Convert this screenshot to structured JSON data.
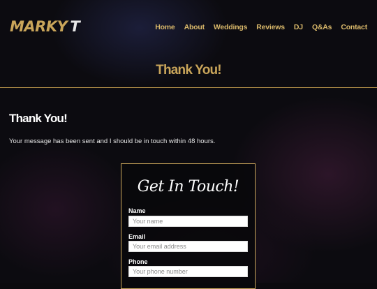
{
  "brand": {
    "logo_text": "MARKY",
    "logo_suffix": "T"
  },
  "nav": {
    "items": [
      {
        "label": "Home"
      },
      {
        "label": "About"
      },
      {
        "label": "Weddings"
      },
      {
        "label": "Reviews"
      },
      {
        "label": "DJ"
      },
      {
        "label": "Q&As"
      },
      {
        "label": "Contact"
      }
    ]
  },
  "hero": {
    "title": "Thank You!"
  },
  "content": {
    "title": "Thank You!",
    "message": "Your message has been sent and I should be in touch within 48 hours."
  },
  "contact_form": {
    "title": "Get In Touch!",
    "fields": [
      {
        "label": "Name",
        "placeholder": "Your name"
      },
      {
        "label": "Email",
        "placeholder": "Your email address"
      },
      {
        "label": "Phone",
        "placeholder": "Your phone number"
      }
    ]
  },
  "colors": {
    "accent": "#c9a55a",
    "background": "#0b0a0e"
  }
}
